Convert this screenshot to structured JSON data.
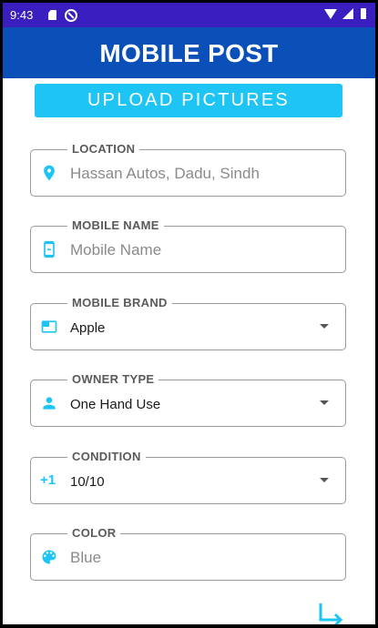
{
  "status_bar": {
    "time": "9:43"
  },
  "app_bar": {
    "title": "MOBILE POST"
  },
  "upload_button": {
    "label": "UPLOAD PICTURES"
  },
  "fields": {
    "location": {
      "label": "LOCATION",
      "placeholder": "Hassan Autos, Dadu, Sindh",
      "icon": "location-pin-icon"
    },
    "mobile_name": {
      "label": "MOBILE NAME",
      "placeholder": "Mobile Name",
      "icon": "phone-icon"
    },
    "mobile_brand": {
      "label": "MOBILE BRAND",
      "value": "Apple",
      "icon": "brand-card-icon"
    },
    "owner_type": {
      "label": "OWNER TYPE",
      "value": "One Hand Use",
      "icon": "person-icon"
    },
    "condition": {
      "label": "CONDITION",
      "value": "10/10",
      "icon_text": "+1"
    },
    "color": {
      "label": "COLOR",
      "placeholder": "Blue",
      "icon": "palette-icon"
    }
  },
  "colors": {
    "status_bar": "#3a1ec0",
    "app_bar": "#0b4fb9",
    "accent": "#1ec5f4"
  }
}
